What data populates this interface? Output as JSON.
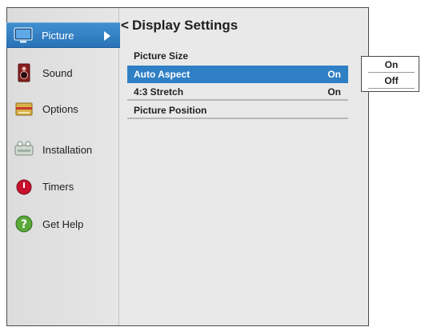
{
  "sidebar": {
    "items": [
      {
        "label": "Picture",
        "icon": "tv-icon",
        "active": true
      },
      {
        "label": "Sound",
        "icon": "speaker-icon"
      },
      {
        "label": "Options",
        "icon": "options-icon"
      },
      {
        "label": "Installation",
        "icon": "installation-icon"
      },
      {
        "label": "Timers",
        "icon": "timer-icon"
      },
      {
        "label": "Get Help",
        "icon": "help-icon"
      }
    ]
  },
  "main": {
    "back_glyph": "<",
    "title": "Display Settings",
    "rows": [
      {
        "label": "Picture Size",
        "value": ""
      },
      {
        "label": "Auto Aspect",
        "value": "On",
        "selected": true
      },
      {
        "label": "4:3 Stretch",
        "value": "On"
      },
      {
        "label": "Picture Position",
        "value": ""
      }
    ]
  },
  "popup": {
    "options": [
      "On",
      "Off"
    ]
  },
  "colors": {
    "accent": "#2f7fc4",
    "sidebar_bg": "#dcdcdc",
    "panel_bg": "#e9e9e9"
  }
}
